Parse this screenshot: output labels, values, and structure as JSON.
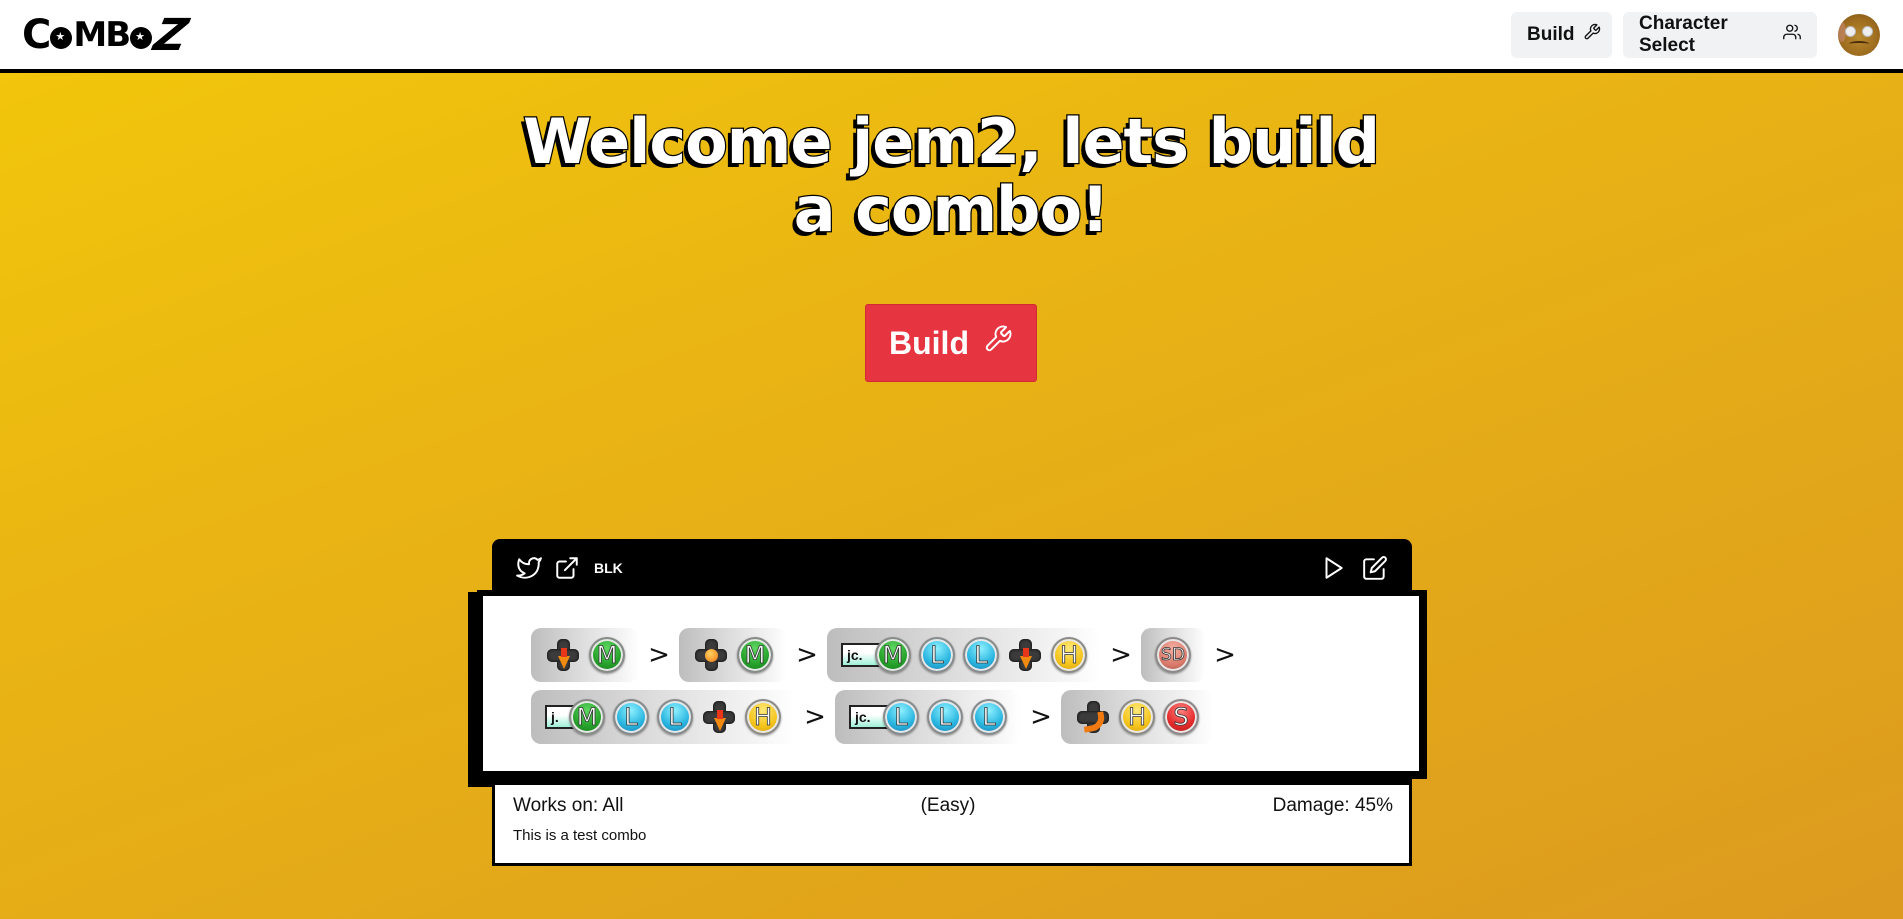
{
  "app": {
    "logo_text": "ComboZ"
  },
  "nav": {
    "build_label": "Build",
    "character_select_label": "Character Select"
  },
  "hero": {
    "title_line1": "Welcome jem2, lets build",
    "title_line2": "a combo!",
    "build_button_label": "Build"
  },
  "colors": {
    "primary_red": "#E63540",
    "bg_gradient_start": "#F3C80A",
    "bg_gradient_end": "#DC9A1F"
  },
  "combo": {
    "header": {
      "tag": "BLK",
      "icons_left": [
        "twitter-icon",
        "external-link-icon"
      ],
      "icons_right": [
        "play-icon",
        "edit-icon"
      ]
    },
    "rows": [
      [
        {
          "inputs": [
            {
              "type": "dpad",
              "dir": "down"
            },
            {
              "type": "btn",
              "label": "M"
            }
          ]
        },
        {
          "inputs": [
            {
              "type": "dpad",
              "dir": "neutral"
            },
            {
              "type": "btn",
              "label": "M"
            }
          ]
        },
        {
          "prefix": "jc.",
          "inputs": [
            {
              "type": "btn",
              "label": "M"
            },
            {
              "type": "btn",
              "label": "L"
            },
            {
              "type": "btn",
              "label": "L"
            },
            {
              "type": "dpad",
              "dir": "down"
            },
            {
              "type": "btn",
              "label": "H"
            }
          ]
        },
        {
          "inputs": [
            {
              "type": "btn",
              "label": "SD"
            }
          ]
        }
      ],
      [
        {
          "prefix": "j.",
          "inputs": [
            {
              "type": "btn",
              "label": "M"
            },
            {
              "type": "btn",
              "label": "L"
            },
            {
              "type": "btn",
              "label": "L"
            },
            {
              "type": "dpad",
              "dir": "down"
            },
            {
              "type": "btn",
              "label": "H"
            }
          ]
        },
        {
          "prefix": "jc.",
          "inputs": [
            {
              "type": "btn",
              "label": "L"
            },
            {
              "type": "btn",
              "label": "L"
            },
            {
              "type": "btn",
              "label": "L"
            }
          ]
        },
        {
          "inputs": [
            {
              "type": "dpad",
              "dir": "quarter-circle-forward"
            },
            {
              "type": "btn",
              "label": "H"
            },
            {
              "type": "btn",
              "label": "S"
            }
          ]
        }
      ]
    ],
    "row_trailing_arrow": [
      true,
      false
    ],
    "separator": ">",
    "works_on": "Works on: All",
    "difficulty": "(Easy)",
    "damage": "Damage: 45%",
    "description": "This is a test combo"
  }
}
